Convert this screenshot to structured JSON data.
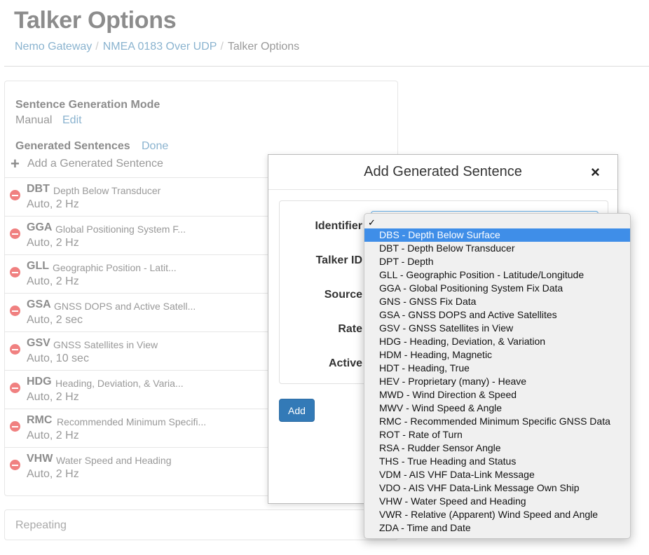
{
  "page": {
    "title": "Talker Options",
    "breadcrumb": [
      "Nemo Gateway",
      "NMEA 0183 Over UDP",
      "Talker Options"
    ]
  },
  "panel": {
    "mode_label": "Sentence Generation Mode",
    "mode_value": "Manual",
    "edit_link": "Edit",
    "generated_label": "Generated Sentences",
    "done_link": "Done",
    "add_label": "Add a Generated Sentence",
    "sentences": [
      {
        "code": "DBT",
        "desc": "Depth Below Transducer",
        "rate": "Auto, 2 Hz"
      },
      {
        "code": "GGA",
        "desc": "Global Positioning System F...",
        "rate": "Auto, 2 Hz"
      },
      {
        "code": "GLL",
        "desc": "Geographic Position - Latit...",
        "rate": "Auto, 2 Hz"
      },
      {
        "code": "GSA",
        "desc": "GNSS DOPS and Active Satell...",
        "rate": "Auto, 2 sec"
      },
      {
        "code": "GSV",
        "desc": "GNSS Satellites in View",
        "rate": "Auto, 10 sec"
      },
      {
        "code": "HDG",
        "desc": "Heading, Deviation, & Varia...",
        "rate": "Auto, 2 Hz"
      },
      {
        "code": "RMC",
        "desc": "Recommended Minimum Specifi...",
        "rate": "Auto, 2 Hz"
      },
      {
        "code": "VHW",
        "desc": "Water Speed and Heading",
        "rate": "Auto, 2 Hz"
      }
    ]
  },
  "repeating_panel": {
    "label": "Repeating"
  },
  "modal": {
    "title": "Add Generated Sentence",
    "close": "×",
    "labels": {
      "identifier": "Identifier",
      "talker_id": "Talker ID",
      "source": "Source",
      "rate": "Rate",
      "active": "Active"
    },
    "add_button": "Add"
  },
  "dropdown": {
    "check": "✓",
    "options": [
      "DBS - Depth Below Surface",
      "DBT - Depth Below Transducer",
      "DPT - Depth",
      "GLL - Geographic Position - Latitude/Longitude",
      "GGA - Global Positioning System Fix Data",
      "GNS - GNSS Fix Data",
      "GSA - GNSS DOPS and Active Satellites",
      "GSV - GNSS Satellites in View",
      "HDG - Heading, Deviation, & Variation",
      "HDM - Heading, Magnetic",
      "HDT - Heading, True",
      "HEV - Proprietary (many) - Heave",
      "MWD - Wind Direction & Speed",
      "MWV - Wind Speed & Angle",
      "RMC - Recommended Minimum Specific GNSS Data",
      "ROT - Rate of Turn",
      "RSA - Rudder Sensor Angle",
      "THS - True Heading and Status",
      "VDM - AIS VHF Data-Link Message",
      "VDO - AIS VHF Data-Link Message Own Ship",
      "VHW - Water Speed and Heading",
      "VWR - Relative (Apparent) Wind Speed and Angle",
      "ZDA - Time and Date"
    ],
    "highlighted_index": 0
  }
}
